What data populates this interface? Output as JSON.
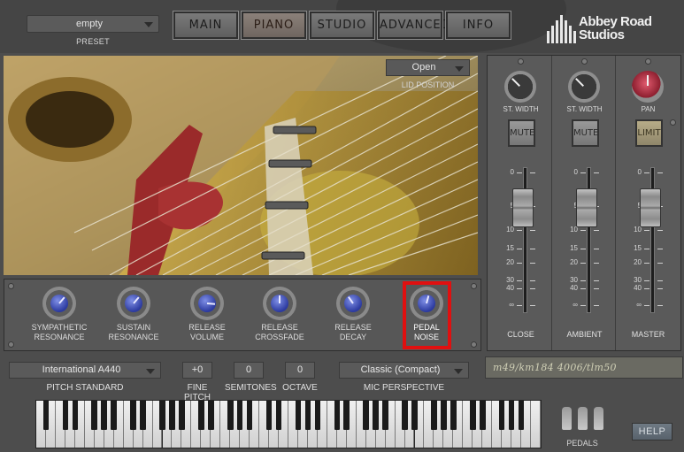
{
  "header": {
    "preset_value": "empty",
    "preset_label": "PRESET",
    "tabs": [
      {
        "label": "MAIN",
        "active": false
      },
      {
        "label": "PIANO",
        "active": true
      },
      {
        "label": "STUDIO",
        "active": false
      },
      {
        "label": "ADVANCED",
        "active": false
      },
      {
        "label": "INFO",
        "active": false
      }
    ],
    "logo_line1": "Abbey Road",
    "logo_line2": "Studios"
  },
  "piano_view": {
    "lid_value": "Open",
    "lid_label": "LID POSITION"
  },
  "knobs": [
    {
      "line1": "SYMPATHETIC",
      "line2": "RESONANCE",
      "level": 0.7
    },
    {
      "line1": "SUSTAIN",
      "line2": "RESONANCE",
      "level": 0.7
    },
    {
      "line1": "RELEASE",
      "line2": "VOLUME",
      "level": 0.85
    },
    {
      "line1": "RELEASE",
      "line2": "CROSSFADE",
      "level": 0.5
    },
    {
      "line1": "RELEASE",
      "line2": "DECAY",
      "level": 0.35
    },
    {
      "line1": "PEDAL",
      "line2": "NOISE",
      "level": 0.55,
      "highlighted": true
    }
  ],
  "mixer": {
    "channels": [
      {
        "knob_label": "ST. WIDTH",
        "button": "MUTE",
        "name": "CLOSE",
        "fader_db": 5
      },
      {
        "knob_label": "ST. WIDTH",
        "button": "MUTE",
        "name": "AMBIENT",
        "fader_db": 5
      },
      {
        "knob_label": "PAN",
        "button": "LIMIT",
        "name": "MASTER",
        "fader_db": 5
      }
    ],
    "scale": [
      "0",
      "5",
      "10",
      "15",
      "20",
      "30",
      "40",
      "∞"
    ],
    "mic_notes": "m49/km184 4006/tlm50"
  },
  "bottom": {
    "pitch_standard_value": "International A440",
    "pitch_standard_label": "PITCH STANDARD",
    "fine_pitch_value": "+0",
    "fine_pitch_label": "FINE PITCH",
    "semitones_value": "0",
    "semitones_label": "SEMITONES",
    "octave_value": "0",
    "octave_label": "OCTAVE",
    "mic_perspective_value": "Classic (Compact)",
    "mic_perspective_label": "MIC PERSPECTIVE",
    "pedals_label": "PEDALS",
    "help_label": "HELP"
  },
  "colors": {
    "background": "#4d4d4d",
    "knob_cap": "#3a4bbd",
    "highlight": "#e01010",
    "pan_knob": "#b8303f"
  }
}
